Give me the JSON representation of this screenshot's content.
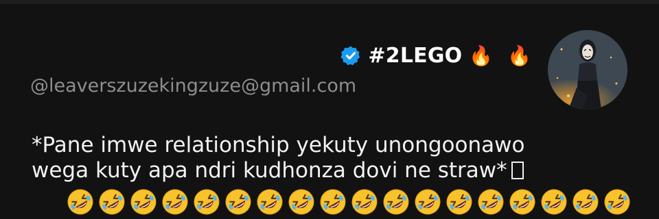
{
  "post": {
    "display_name": "#2LEGO",
    "flames": "🔥 🔥",
    "handle": "@leaverszuzekingzuze@gmail.com",
    "message_line1": "*Pane imwe relationship yekuty unongoonawo",
    "message_line2": "wega kuty apa ndri kudhonza dovi ne straw*",
    "emoji_count": 18
  },
  "icons": {
    "verified": "verified-badge-icon",
    "flame": "fire-emoji",
    "laugh": "rolling-on-floor-laughing-emoji",
    "avatar": "masked-person-avatar"
  },
  "colors": {
    "background": "#121212",
    "verified_blue": "#1d9bf0",
    "handle_gray": "#8e8e8e",
    "text": "#f2f2f2"
  }
}
